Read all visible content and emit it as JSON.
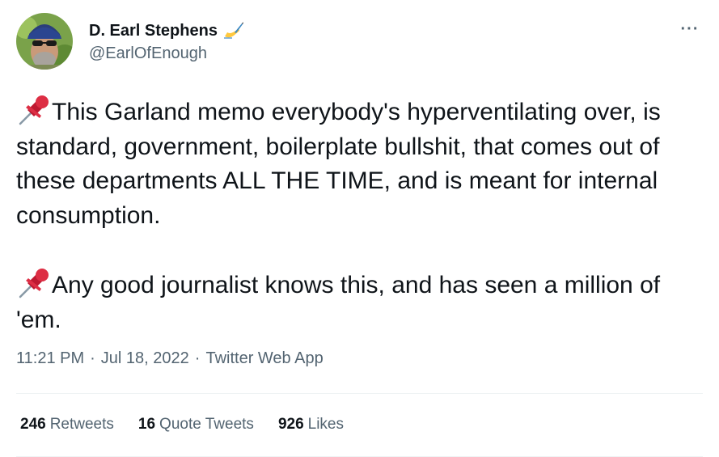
{
  "author": {
    "display_name": "D. Earl Stephens",
    "handle": "@EarlOfEnough",
    "name_emoji": "writing-hand-icon"
  },
  "tweet": {
    "paragraphs": [
      {
        "emoji": "pushpin-icon",
        "text": "This Garland memo everybody's hyperventilating over, is standard, government, boilerplate bullshit, that comes out of these departments ALL THE TIME, and is meant for internal consumption."
      },
      {
        "emoji": "pushpin-icon",
        "text": "Any good journalist knows this, and has seen a million of 'em."
      }
    ],
    "time": "11:21 PM",
    "date": "Jul 18, 2022",
    "source": "Twitter Web App",
    "separator": "·"
  },
  "stats": {
    "retweets": {
      "count": "246",
      "label": "Retweets"
    },
    "quote_tweets": {
      "count": "16",
      "label": "Quote Tweets"
    },
    "likes": {
      "count": "926",
      "label": "Likes"
    }
  },
  "menu": {
    "more_label": "···"
  },
  "colors": {
    "text_primary": "#0f1419",
    "text_secondary": "#536471",
    "divider": "#eff3f4",
    "pin_red": "#e0245e"
  }
}
